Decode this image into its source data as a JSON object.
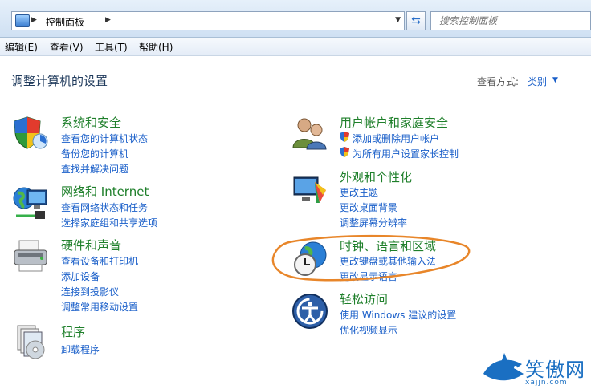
{
  "address": {
    "path": "控制面板"
  },
  "search": {
    "placeholder": "搜索控制面板"
  },
  "menu": [
    "编辑(E)",
    "查看(V)",
    "工具(T)",
    "帮助(H)"
  ],
  "page_title": "调整计算机的设置",
  "view": {
    "label": "查看方式:",
    "value": "类别"
  },
  "categories": {
    "system": {
      "title": "系统和安全",
      "links": [
        "查看您的计算机状态",
        "备份您的计算机",
        "查找并解决问题"
      ],
      "icon": "shield-icon"
    },
    "network": {
      "title": "网络和 Internet",
      "links": [
        "查看网络状态和任务",
        "选择家庭组和共享选项"
      ],
      "icon": "network-icon"
    },
    "hardware": {
      "title": "硬件和声音",
      "links": [
        "查看设备和打印机",
        "添加设备",
        "连接到投影仪",
        "调整常用移动设置"
      ],
      "icon": "printer-icon"
    },
    "programs": {
      "title": "程序",
      "links": [
        "卸载程序"
      ],
      "icon": "programs-icon"
    },
    "users": {
      "title": "用户帐户和家庭安全",
      "links": [
        "添加或删除用户帐户",
        "为所有用户设置家长控制"
      ],
      "icon": "users-icon"
    },
    "appearance": {
      "title": "外观和个性化",
      "links": [
        "更改主题",
        "更改桌面背景",
        "调整屏幕分辨率"
      ],
      "icon": "appearance-icon"
    },
    "clock": {
      "title": "时钟、语言和区域",
      "links": [
        "更改键盘或其他输入法",
        "更改显示语言"
      ],
      "icon": "clock-globe-icon"
    },
    "ease": {
      "title": "轻松访问",
      "links": [
        "使用 Windows 建议的设置",
        "优化视频显示"
      ],
      "icon": "ease-of-access-icon"
    }
  },
  "watermark": {
    "text": "笑傲网",
    "sub": "xajjn.com"
  },
  "colors": {
    "heading": "#1e7f2a",
    "link": "#1a5fc9",
    "annotation": "#e8862a"
  }
}
